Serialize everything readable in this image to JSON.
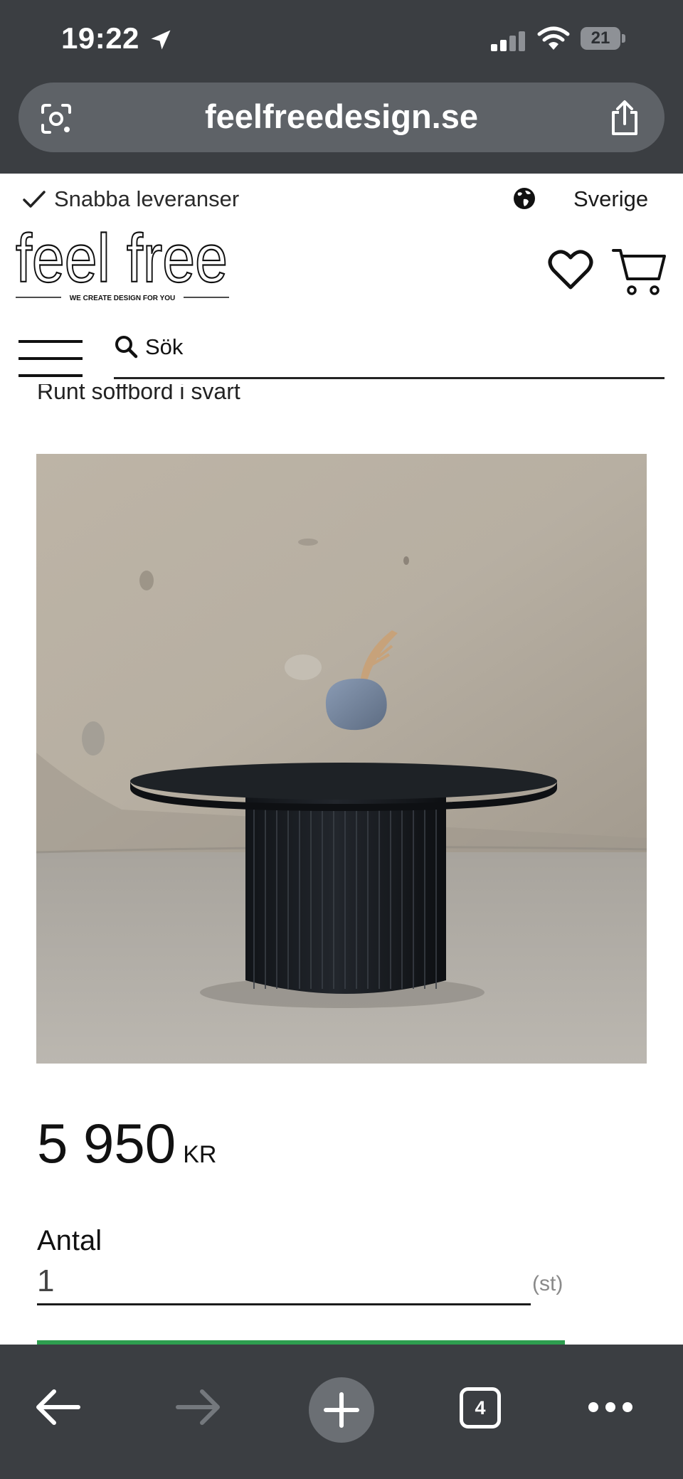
{
  "status_bar": {
    "time": "19:22",
    "battery": "21"
  },
  "browser": {
    "url": "feelfreedesign.se",
    "tab_count": "4"
  },
  "site": {
    "delivery_note": "Snabba leveranser",
    "country": "Sverige",
    "logo_text": "feel free",
    "logo_tagline": "WE CREATE DESIGN FOR YOU",
    "search_placeholder": "Sök"
  },
  "product": {
    "title": "Runt soffbord i svart",
    "price": "5 950",
    "currency": "KR",
    "quantity_label": "Antal",
    "quantity_value": "1",
    "quantity_unit": "(st)"
  },
  "colors": {
    "chrome": "#3b3e42",
    "accent_green": "#2e9e4f"
  },
  "icons": [
    "location-arrow-icon",
    "signal-icon",
    "wifi-icon",
    "battery-icon",
    "lens-icon",
    "share-icon",
    "checkmark-icon",
    "globe-icon",
    "heart-icon",
    "cart-icon",
    "hamburger-menu-icon",
    "search-icon",
    "back-arrow-icon",
    "forward-arrow-icon",
    "plus-icon",
    "tabs-icon",
    "more-icon"
  ]
}
